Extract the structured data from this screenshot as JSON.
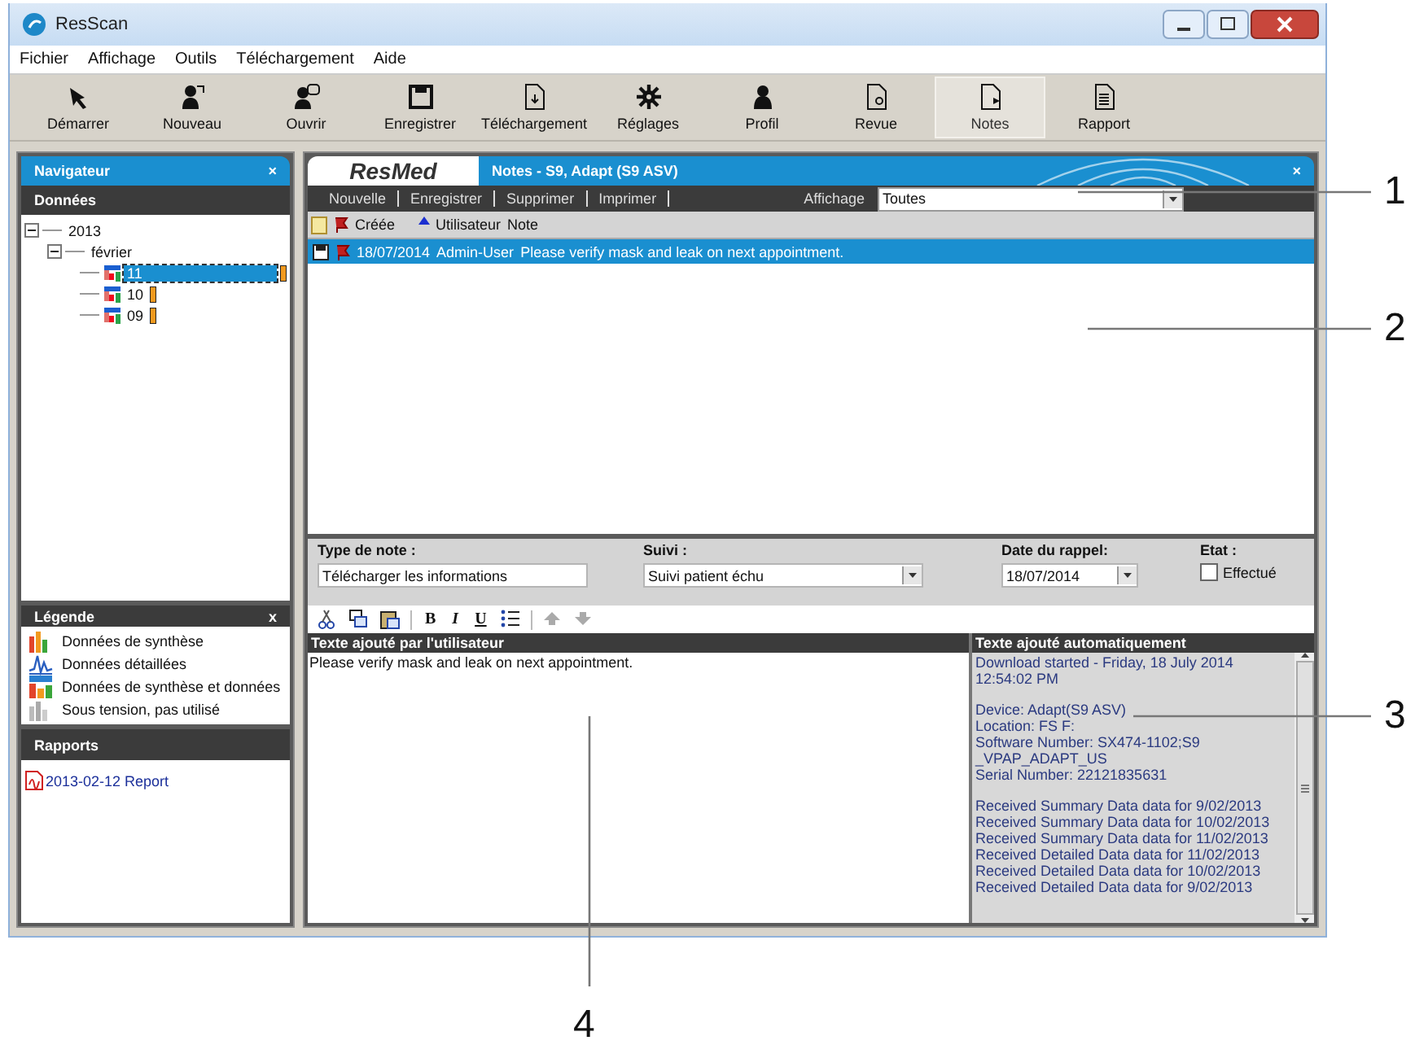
{
  "window": {
    "title": "ResScan"
  },
  "menu": [
    {
      "label": "Fichier"
    },
    {
      "label": "Affichage"
    },
    {
      "label": "Outils"
    },
    {
      "label": "Téléchargement"
    },
    {
      "label": "Aide"
    }
  ],
  "toolbar": [
    {
      "label": "Démarrer",
      "kind": "start",
      "selected": false
    },
    {
      "label": "Nouveau",
      "kind": "new",
      "selected": false
    },
    {
      "label": "Ouvrir",
      "kind": "open",
      "selected": false
    },
    {
      "label": "Enregistrer",
      "kind": "save",
      "selected": false
    },
    {
      "label": "Téléchargement",
      "kind": "download",
      "selected": false
    },
    {
      "label": "Réglages",
      "kind": "settings",
      "selected": false
    },
    {
      "label": "Profil",
      "kind": "profile",
      "selected": false
    },
    {
      "label": "Revue",
      "kind": "review",
      "selected": false
    },
    {
      "label": "Notes",
      "kind": "notes",
      "selected": true
    },
    {
      "label": "Rapport",
      "kind": "report",
      "selected": false
    }
  ],
  "navigator": {
    "title": "Navigateur",
    "close": "×",
    "section": "Données",
    "tree": [
      {
        "label": "2013",
        "expanded": true,
        "children": [
          {
            "label": "février",
            "expanded": true,
            "children": [
              {
                "label": "11",
                "selected": true
              },
              {
                "label": "10",
                "selected": false
              },
              {
                "label": "09",
                "selected": false
              }
            ]
          }
        ]
      }
    ],
    "legend": {
      "title": "Légende",
      "close": "x",
      "items": [
        {
          "label": "Données de synthèse",
          "kind": "summary"
        },
        {
          "label": "Données détaillées",
          "kind": "detailed"
        },
        {
          "label": "Données de synthèse et données",
          "kind": "both"
        },
        {
          "label": "Sous tension, pas utilisé",
          "kind": "powered"
        }
      ]
    },
    "reports": {
      "title": "Rapports",
      "items": [
        {
          "label": "2013-02-12 Report"
        }
      ]
    }
  },
  "notes": {
    "brand": "ResMed",
    "title": "Notes - S9, Adapt (S9 ASV)",
    "close": "×",
    "actions": [
      "Nouvelle",
      "Enregistrer",
      "Supprimer",
      "Imprimer"
    ],
    "filter": {
      "label": "Affichage",
      "value": "Toutes"
    },
    "columns": [
      {
        "label": "Créée",
        "sorted": true
      },
      {
        "label": "Utilisateur",
        "sorted": false
      },
      {
        "label": "Note",
        "sorted": false
      }
    ],
    "rows": [
      {
        "created": "18/07/2014",
        "user": "Admin-User",
        "note": "Please verify mask and leak on next appointment.",
        "selected": true
      }
    ],
    "form": {
      "note_type": {
        "label": "Type de note :",
        "value": "Télécharger les informations"
      },
      "follow_up": {
        "label": "Suivi :",
        "value": "Suivi patient échu"
      },
      "reminder": {
        "label": "Date du rappel:",
        "value": "18/07/2014"
      },
      "state": {
        "label": "Etat :",
        "option": "Effectué",
        "checked": false
      }
    },
    "format_buttons": [
      {
        "kind": "cut"
      },
      {
        "kind": "copy"
      },
      {
        "kind": "paste"
      },
      {
        "kind": "bold",
        "label": "B"
      },
      {
        "kind": "italic",
        "label": "I"
      },
      {
        "kind": "underline",
        "label": "U"
      },
      {
        "kind": "list"
      },
      {
        "kind": "up"
      },
      {
        "kind": "down"
      }
    ],
    "user_text": {
      "title": "Texte ajouté par l'utilisateur",
      "text": "Please verify mask and leak on next appointment."
    },
    "auto_text": {
      "title": "Texte ajouté automatiquement",
      "paragraphs": [
        [
          "Download started - Friday, 18 July 2014 12:54:02 PM"
        ],
        [
          "Device: Adapt(S9 ASV)",
          "Location: FS F:",
          "Software Number: SX474-1102;S9 _VPAP_ADAPT_US",
          "Serial Number: 22121835631"
        ],
        [
          "Received Summary Data data for 9/02/2013",
          "Received Summary Data data for 10/02/2013",
          "Received Summary Data data for 11/02/2013",
          "Received Detailed Data data for 11/02/2013",
          "Received Detailed Data data for 10/02/2013",
          "Received Detailed Data data for 9/02/2013"
        ]
      ]
    }
  },
  "callouts": [
    {
      "label": "1"
    },
    {
      "label": "2"
    },
    {
      "label": "3"
    },
    {
      "label": "4"
    }
  ]
}
